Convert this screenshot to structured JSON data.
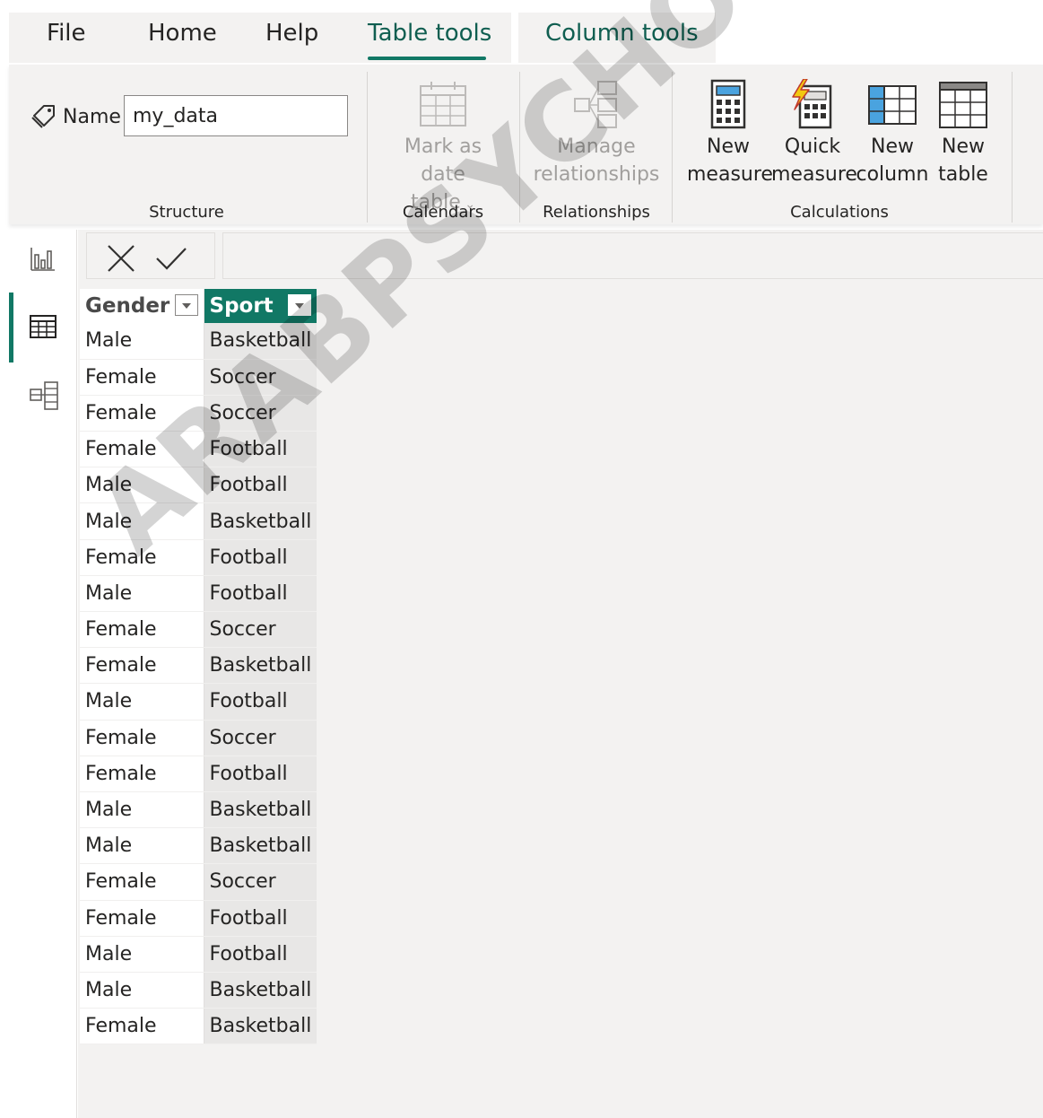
{
  "tabs": {
    "file": "File",
    "home": "Home",
    "help": "Help",
    "table_tools": "Table tools",
    "column_tools": "Column tools"
  },
  "structure": {
    "name_label": "Name",
    "name_value": "my_data",
    "group_label": "Structure"
  },
  "calendars": {
    "mark_as_date_line1": "Mark as date",
    "mark_as_date_line2": "table",
    "group_label": "Calendars"
  },
  "relationships": {
    "manage_line1": "Manage",
    "manage_line2": "relationships",
    "group_label": "Relationships"
  },
  "calculations": {
    "new_measure_line1": "New",
    "new_measure_line2": "measure",
    "quick_measure_line1": "Quick",
    "quick_measure_line2": "measure",
    "new_column_line1": "New",
    "new_column_line2": "column",
    "new_table_line1": "New",
    "new_table_line2": "table",
    "group_label": "Calculations"
  },
  "icons": {
    "tag": "tag-icon",
    "report_view": "bar-chart-icon",
    "table_view": "table-grid-icon",
    "model_view": "model-diagram-icon",
    "cancel": "close-icon",
    "commit": "checkmark-icon",
    "filter": "chevron-down-icon"
  },
  "colors": {
    "accent": "#117865",
    "tab_text": "#0f5e50",
    "quick_measure_bolt": "#f2c811",
    "new_column_fill": "#4aa3df"
  },
  "table": {
    "columns": [
      "Gender",
      "Sport"
    ],
    "rows": [
      [
        "Male",
        "Basketball"
      ],
      [
        "Female",
        "Soccer"
      ],
      [
        "Female",
        "Soccer"
      ],
      [
        "Female",
        "Football"
      ],
      [
        "Male",
        "Football"
      ],
      [
        "Male",
        "Basketball"
      ],
      [
        "Female",
        "Football"
      ],
      [
        "Male",
        "Football"
      ],
      [
        "Female",
        "Soccer"
      ],
      [
        "Female",
        "Basketball"
      ],
      [
        "Male",
        "Football"
      ],
      [
        "Female",
        "Soccer"
      ],
      [
        "Female",
        "Football"
      ],
      [
        "Male",
        "Basketball"
      ],
      [
        "Male",
        "Basketball"
      ],
      [
        "Female",
        "Soccer"
      ],
      [
        "Female",
        "Football"
      ],
      [
        "Male",
        "Football"
      ],
      [
        "Male",
        "Basketball"
      ],
      [
        "Female",
        "Basketball"
      ]
    ]
  },
  "watermark": "ARABPSYCHOLOGY.COM"
}
